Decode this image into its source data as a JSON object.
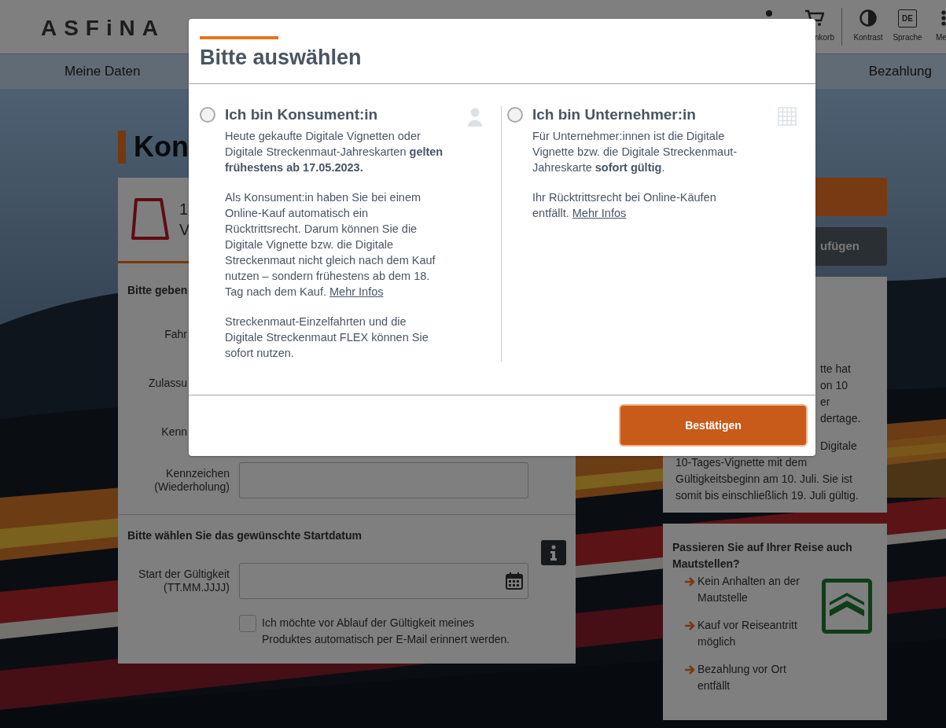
{
  "header": {
    "logo": "ASFiNA",
    "actions": [
      {
        "kind": "person"
      },
      {
        "kind": "cart",
        "label": "nkorb"
      },
      {
        "kind": "contrast",
        "label": "Kontrast"
      },
      {
        "kind": "language",
        "badge": "DE",
        "label": "Sprache"
      },
      {
        "kind": "menu",
        "label": "Me"
      }
    ]
  },
  "nav": {
    "items": [
      "Meine Daten",
      "Bezahlung"
    ]
  },
  "page": {
    "title": "Kon",
    "product": {
      "line_1": "1",
      "line_2": "V"
    },
    "vehicle_section": {
      "heading": "Bitte geben",
      "rows": [
        {
          "kind": "partial",
          "label": "Fahr"
        },
        {
          "kind": "partial",
          "label": "Zulassu"
        },
        {
          "kind": "partial",
          "label": "Kenn"
        },
        {
          "kind": "input",
          "label": "Kennzeichen (Wiederholung)"
        }
      ]
    },
    "date_section": {
      "heading": "Bitte wählen Sie das gewünschte Startdatum",
      "field_label": "Start der Gültigkeit (TT.MM.JJJJ)",
      "reminder": {
        "label": "Ich möchte vor Ablauf der Gültigkeit meines Produktes automatisch per E-Mail erinnert werden.",
        "checked": false
      }
    }
  },
  "sidebar": {
    "buttons": [
      {
        "kind": "primary"
      },
      {
        "kind": "secondary",
        "label": "ufügen"
      }
    ],
    "info_card": {
      "paragraphs": [
        [
          {
            "kind": "partial",
            "text": "tte hat"
          },
          {
            "kind": "partial",
            "text": "on 10"
          },
          {
            "kind": "partial",
            "text": "er"
          },
          {
            "kind": "partial",
            "text": "dertage."
          }
        ],
        [
          {
            "kind": "partial",
            "text": "Digitale"
          },
          {
            "kind": "full",
            "text": "10-Tages-Vignette mit dem"
          },
          {
            "kind": "full",
            "text": "Gültigkeitsbeginn am 10. Juli. Sie ist"
          },
          {
            "kind": "full",
            "text": "somit bis einschließlich 19. Juli gültig."
          }
        ]
      ]
    },
    "toll_card": {
      "heading": "Passieren Sie auf Ihrer Reise auch Mautstellen?",
      "bullets": [
        "Kein Anhalten an der Mautstelle",
        "Kauf vor Reiseantritt möglich",
        "Bezahlung vor Ort entfällt"
      ]
    }
  },
  "dialog": {
    "title": "Bitte auswählen",
    "options": [
      {
        "kind": "consumer",
        "title": "Ich bin Konsument:in",
        "selected": false,
        "paragraphs": [
          {
            "text": "Heute gekaufte Digitale Vignetten oder Digitale Streckenmaut-Jahreskarten **gelten frühestens ab 17.05.2023.**"
          },
          {
            "text": "Als Konsument:in haben Sie bei einem Online-Kauf automatisch ein Rücktrittsrecht. Darum können Sie die Digitale Vignette bzw. die Digitale Streckenmaut nicht gleich nach dem Kauf nutzen – sondern frühestens ab dem 18. Tag nach dem Kauf.",
            "link": "Mehr Infos"
          },
          {
            "text": "Streckenmaut-Einzelfahrten und die Digitale Streckenmaut FLEX können Sie sofort nutzen."
          }
        ]
      },
      {
        "kind": "business",
        "title": "Ich bin Unternehmer:in",
        "selected": false,
        "paragraphs": [
          {
            "text": "Für Unternehmer:innen ist die Digitale Vignette bzw. die Digitale Streckenmaut-Jahreskarte **sofort gültig**."
          },
          {
            "text": "Ihr Rücktrittsrecht bei Online-Käufen entfällt.",
            "link": "Mehr Infos"
          }
        ]
      }
    ],
    "confirm_button": "Bestätigen"
  }
}
